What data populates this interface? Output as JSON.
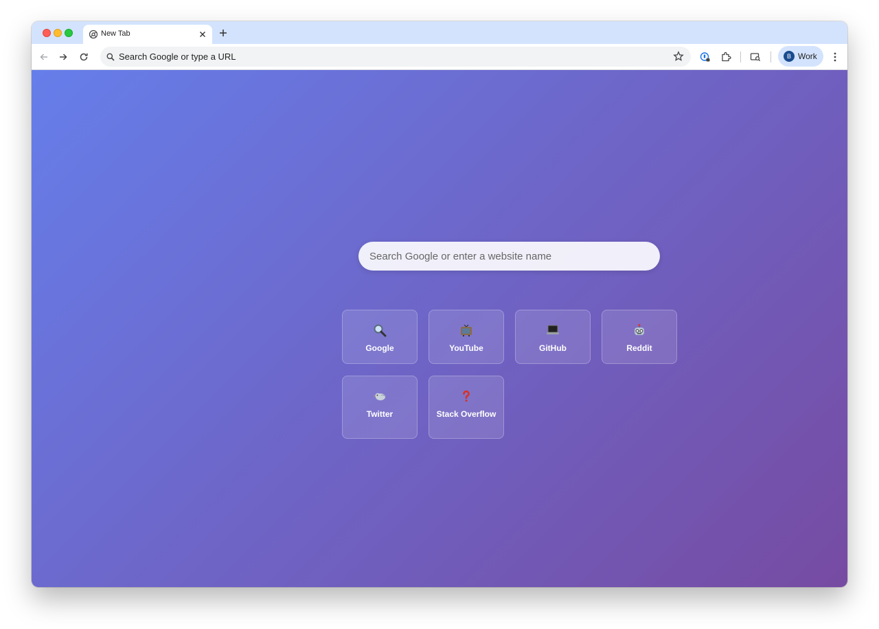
{
  "browser": {
    "tab": {
      "title": "New Tab"
    },
    "omnibox": {
      "text": "Search Google or type a URL"
    },
    "profile": {
      "initial": "B",
      "label": "Work"
    }
  },
  "ntp": {
    "search_placeholder": "Search Google or enter a website name",
    "shortcuts": [
      {
        "label": "Google",
        "icon": "magnifier-icon",
        "glyph": "🔍"
      },
      {
        "label": "YouTube",
        "icon": "tv-icon",
        "glyph": "📺"
      },
      {
        "label": "GitHub",
        "icon": "laptop-icon",
        "glyph": "💻"
      },
      {
        "label": "Reddit",
        "icon": "robot-icon",
        "glyph": "🤖"
      },
      {
        "label": "Twitter",
        "icon": "bird-icon",
        "glyph": "🐦"
      },
      {
        "label": "Stack Overflow",
        "icon": "question-mark-icon",
        "glyph": "❓"
      }
    ]
  },
  "colors": {
    "gradient_start": "#667eea",
    "gradient_end": "#764ba2",
    "tabstrip": "#d3e3fd"
  }
}
